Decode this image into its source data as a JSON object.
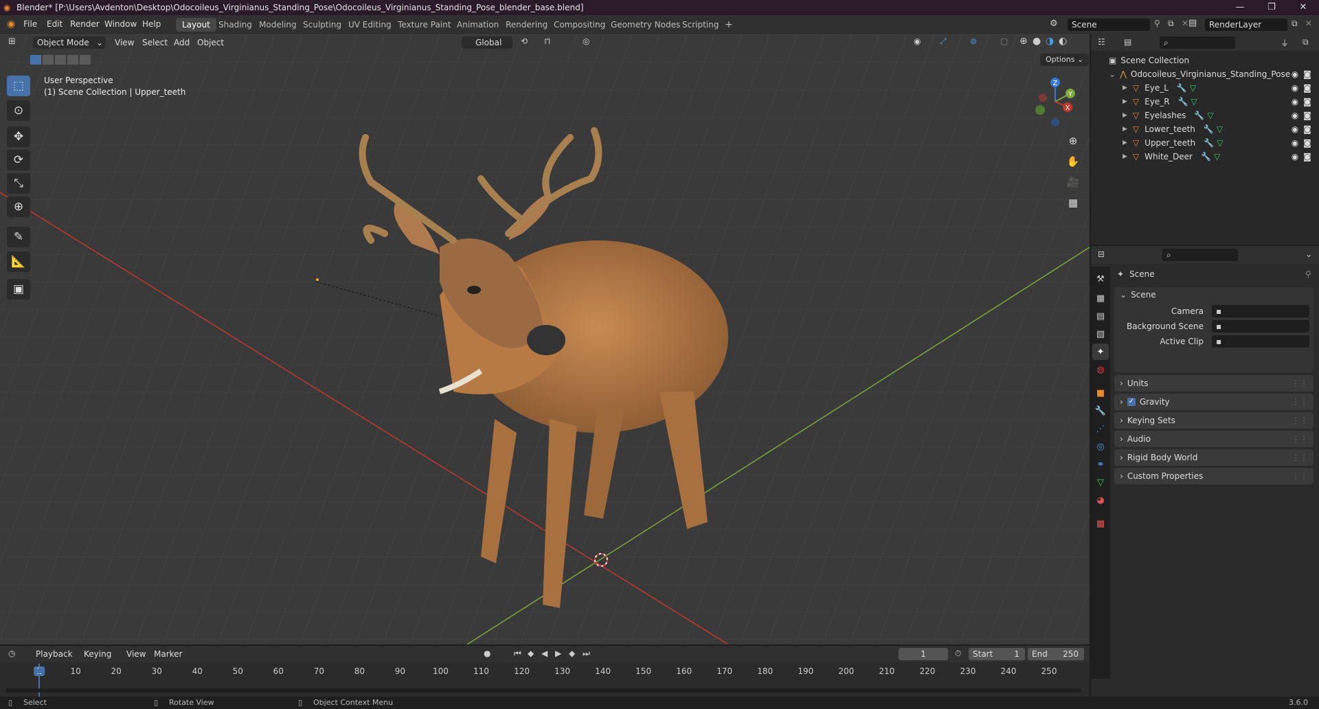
{
  "window": {
    "title": "Blender* [P:\\Users\\Avdenton\\Desktop\\Odocoileus_Virginianus_Standing_Pose\\Odocoileus_Virginianus_Standing_Pose_blender_base.blend]",
    "minimize": "—",
    "maximize": "❐",
    "close": "✕"
  },
  "menu": [
    "File",
    "Edit",
    "Render",
    "Window",
    "Help"
  ],
  "workspaces": [
    "Layout",
    "Shading",
    "Modeling",
    "Sculpting",
    "UV Editing",
    "Texture Paint",
    "Animation",
    "Rendering",
    "Compositing",
    "Geometry Nodes",
    "Scripting",
    "+"
  ],
  "scene_field": "Scene",
  "renderlayer_field": "RenderLayer",
  "viewport": {
    "mode": "Object Mode",
    "menus": [
      "View",
      "Select",
      "Add",
      "Object"
    ],
    "orientation": "Global",
    "options": "Options",
    "perspective": "User Perspective",
    "collection_info": "(1) Scene Collection | Upper_teeth",
    "gizmo": {
      "z": "Z",
      "y": "Y",
      "x": "X"
    }
  },
  "outliner": {
    "root": "Scene Collection",
    "collection": "Odocoileus_Virginianus_Standing_Pose",
    "objects": [
      "Eye_L",
      "Eye_R",
      "Eyelashes",
      "Lower_teeth",
      "Upper_teeth",
      "White_Deer"
    ]
  },
  "properties": {
    "header": "Scene",
    "section": "Scene",
    "fields": [
      {
        "label": "Camera",
        "value": ""
      },
      {
        "label": "Background Scene",
        "value": ""
      },
      {
        "label": "Active Clip",
        "value": ""
      }
    ],
    "panels": [
      "Units",
      "Gravity",
      "Keying Sets",
      "Audio",
      "Rigid Body World",
      "Custom Properties"
    ],
    "gravity_checked": true
  },
  "timeline": {
    "menus": [
      "Playback",
      "Keying",
      "View",
      "Marker"
    ],
    "current_frame": "1",
    "start_label": "Start",
    "start": "1",
    "end_label": "End",
    "end": "250",
    "ticks": [
      "1",
      "10",
      "20",
      "30",
      "40",
      "50",
      "60",
      "70",
      "80",
      "90",
      "100",
      "110",
      "120",
      "130",
      "140",
      "150",
      "160",
      "170",
      "180",
      "190",
      "200",
      "210",
      "220",
      "230",
      "240",
      "250"
    ]
  },
  "statusbar": {
    "select": "Select",
    "rotate": "Rotate View",
    "context": "Object Context Menu",
    "version": "3.6.0"
  },
  "colors": {
    "accent": "#4671a9",
    "x_axis": "#c0392b",
    "y_axis": "#7aa83a",
    "z_axis": "#3b77d4"
  }
}
